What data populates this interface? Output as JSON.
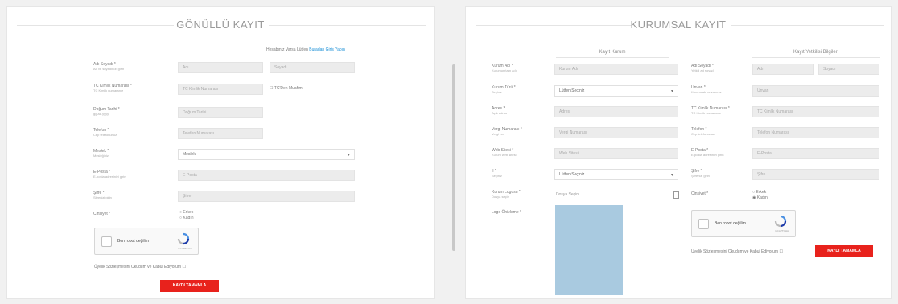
{
  "gonullu": {
    "title": "GÖNÜLLÜ KAYIT",
    "login_prompt": "Hesabınız Varsa Lütfen",
    "login_link": "Buradan Giriş Yapın",
    "fields": [
      {
        "label": "Adı Soyadı *",
        "sub": "Ad ve soyadınızı girin",
        "values": [
          "Adı",
          "Soyadı"
        ]
      },
      {
        "label": "TC Kimlik Numarası *",
        "sub": "TC Kimlik numaranız",
        "values": [
          "TC Kimlik Numarası"
        ],
        "extra": "TC'Den Muafım"
      },
      {
        "label": "Doğum Tarihi *",
        "sub": "gg.aa.yyyy",
        "values": [
          "Doğum Tarihi"
        ]
      },
      {
        "label": "Telefon *",
        "sub": "Cep telefonunuz",
        "values": [
          "Telefon Numarası"
        ]
      },
      {
        "label": "Meslek *",
        "sub": "Mesleğiniz",
        "select": "Meslek"
      },
      {
        "label": "E-Posta *",
        "sub": "E-posta adresinizi girin",
        "values": [
          "E-Posta"
        ]
      },
      {
        "label": "Şifre *",
        "sub": "Şifrenizi girin",
        "values": [
          "Şifre"
        ]
      },
      {
        "label": "Cinsiyet *",
        "sub": "",
        "radios": [
          "Erkek",
          "Kadın"
        ]
      }
    ],
    "captcha_text": "Ben robot değilim",
    "captcha_brand": "reCAPTCHA",
    "kvkk": "Üyelik Sözleşmesini Okudum ve Kabul Ediyorum",
    "submit": "KAYDI TAMAMLA"
  },
  "kurumsal": {
    "title": "KURUMSAL KAYIT",
    "left_head": "Kayıt Kurum",
    "right_head": "Kayıt Yetkilisi Bilgileri",
    "left_fields": [
      {
        "label": "Kurum Adı *",
        "sub": "Kurumun tam adı",
        "values": [
          "Kurum Adı"
        ]
      },
      {
        "label": "Kurum Türü *",
        "sub": "Seçiniz",
        "select": "Lütfen Seçiniz"
      },
      {
        "label": "Adres *",
        "sub": "Açık adres",
        "values": [
          "Adres"
        ]
      },
      {
        "label": "Vergi Numarası *",
        "sub": "Vergi no",
        "values": [
          "Vergi Numarası"
        ]
      },
      {
        "label": "Web Sitesi *",
        "sub": "Kurum web sitesi",
        "values": [
          "Web Sitesi"
        ]
      },
      {
        "label": "İl *",
        "sub": "Seçiniz",
        "select": "Lütfen Seçiniz"
      },
      {
        "label": "Kurum Logosu *",
        "sub": "Dosya seçin",
        "file": "Dosya Seçin"
      },
      {
        "label": "Logo Önizleme *",
        "sub": ""
      }
    ],
    "right_fields": [
      {
        "label": "Adı Soyadı *",
        "sub": "Yetkili ad soyad",
        "values": [
          "Adı",
          "Soyadı"
        ]
      },
      {
        "label": "Unvan *",
        "sub": "Kurumdaki unvanınız",
        "values": [
          "Unvan"
        ]
      },
      {
        "label": "TC Kimlik Numarası *",
        "sub": "TC Kimlik numaranız",
        "values": [
          "TC Kimlik Numarası"
        ]
      },
      {
        "label": "Telefon *",
        "sub": "Cep telefonunuz",
        "values": [
          "Telefon Numarası"
        ]
      },
      {
        "label": "E-Posta *",
        "sub": "E-posta adresinizi girin",
        "values": [
          "E-Posta"
        ]
      },
      {
        "label": "Şifre *",
        "sub": "Şifrenizi girin",
        "values": [
          "Şifre"
        ]
      },
      {
        "label": "Cinsiyet *",
        "sub": "",
        "radios": [
          "Erkek",
          "Kadın"
        ]
      }
    ],
    "captcha_text": "Ben robot değilim",
    "captcha_brand": "reCAPTCHA",
    "kvkk": "Üyelik Sözleşmesini Okudum ve Kabul Ediyorum",
    "submit": "KAYDI TAMAMLA"
  },
  "colors": {
    "accent": "#e8221c",
    "link": "#1a8fd6",
    "preview": "#a9cae0"
  }
}
